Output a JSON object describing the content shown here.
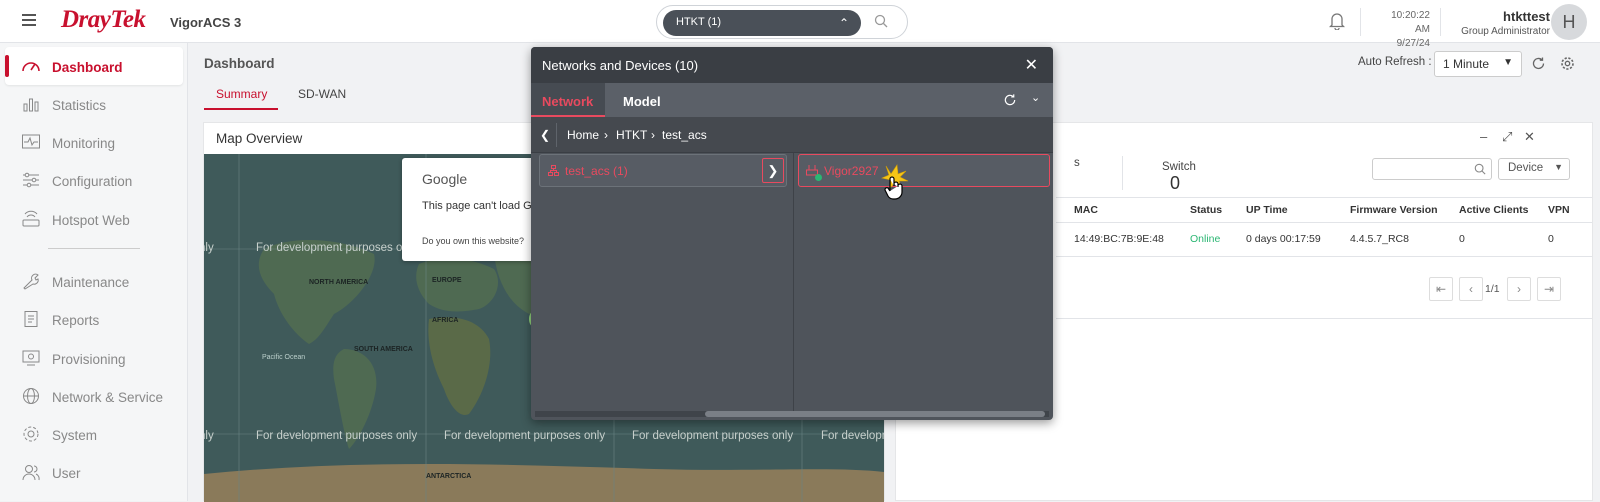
{
  "header": {
    "brand": "DrayTek",
    "product": "VigorACS 3",
    "network_selector": "HTKT (1)",
    "time": "10:20:22 AM",
    "date": "9/27/24",
    "username": "htkttest",
    "role": "Group Administrator",
    "avatar_initial": "H"
  },
  "sidebar": {
    "items": [
      {
        "label": "Dashboard",
        "icon": "gauge-icon"
      },
      {
        "label": "Statistics",
        "icon": "bar-chart-icon"
      },
      {
        "label": "Monitoring",
        "icon": "pulse-icon"
      },
      {
        "label": "Configuration",
        "icon": "sliders-icon"
      },
      {
        "label": "Hotspot Web",
        "icon": "router-icon"
      },
      {
        "label": "Maintenance",
        "icon": "wrench-icon"
      },
      {
        "label": "Reports",
        "icon": "report-icon"
      },
      {
        "label": "Provisioning",
        "icon": "provisioning-icon"
      },
      {
        "label": "Network & Service",
        "icon": "globe-icon"
      },
      {
        "label": "System",
        "icon": "gear-icon"
      },
      {
        "label": "User",
        "icon": "users-icon"
      }
    ]
  },
  "main": {
    "title": "Dashboard",
    "tabs": [
      "Summary",
      "SD-WAN"
    ],
    "auto_refresh_label": "Auto Refresh :",
    "auto_refresh_value": "1 Minute"
  },
  "map": {
    "title": "Map Overview",
    "dev_text": "For development purposes only",
    "dialog_brand": "Google",
    "dialog_message": "This page can't load Goo",
    "dialog_question": "Do you own this website?",
    "continents": [
      "NORTH AMERICA",
      "EUROPE",
      "AFRICA",
      "SOUTH AMERICA",
      "ANTARCTICA",
      "Pacific Ocean"
    ]
  },
  "device_panel": {
    "stat_partial": "s",
    "switch_label": "Switch",
    "switch_count": "0",
    "type_filter": "Device",
    "columns": [
      "MAC",
      "Status",
      "UP Time",
      "Firmware Version",
      "Active Clients",
      "VPN"
    ],
    "rows": [
      {
        "mac": "14:49:BC:7B:9E:48",
        "status": "Online",
        "uptime": "0 days 00:17:59",
        "firmware": "4.4.5.7_RC8",
        "clients": "0",
        "vpn": "0"
      }
    ],
    "page": "1/1"
  },
  "modal": {
    "title": "Networks and Devices (10)",
    "tabs": [
      "Network",
      "Model"
    ],
    "breadcrumb": [
      "Home",
      "HTKT",
      "test_acs"
    ],
    "left_item": "test_acs (1)",
    "right_item": "Vigor2927"
  },
  "colors": {
    "accent": "#c8102e",
    "online": "#2bb673",
    "modal_bg": "#4f545b"
  }
}
